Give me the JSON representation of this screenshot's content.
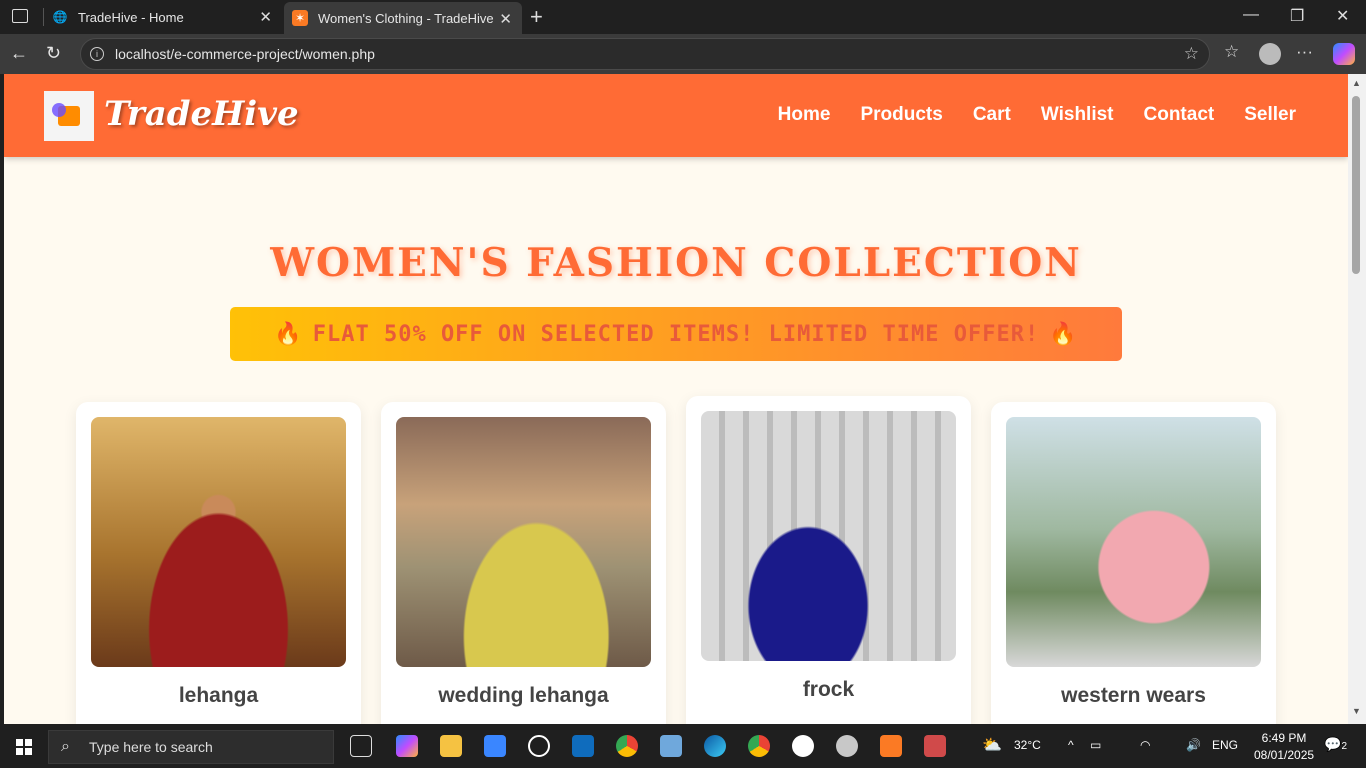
{
  "browser": {
    "tabs": [
      {
        "label": "TradeHive - Home",
        "active": false
      },
      {
        "label": "Women's Clothing - TradeHive",
        "active": true
      }
    ],
    "url": "localhost/e-commerce-project/women.php"
  },
  "site": {
    "brand": "TradeHive",
    "nav": [
      "Home",
      "Products",
      "Cart",
      "Wishlist",
      "Contact",
      "Seller"
    ]
  },
  "main": {
    "title": "WOMEN'S FASHION COLLECTION",
    "promo": "FLAT 50% OFF ON SELECTED ITEMS! LIMITED TIME OFFER!",
    "promo_emoji": "🔥",
    "products": [
      {
        "name": "lehanga"
      },
      {
        "name": "wedding lehanga"
      },
      {
        "name": "frock"
      },
      {
        "name": "western wears"
      }
    ]
  },
  "taskbar": {
    "search_placeholder": "Type here to search",
    "weather": "32°C",
    "language": "ENG",
    "time": "6:49 PM",
    "date": "08/01/2025",
    "notifications": "2"
  },
  "colors": {
    "brand_orange": "#ff6b35",
    "page_bg": "#fffaf0"
  }
}
